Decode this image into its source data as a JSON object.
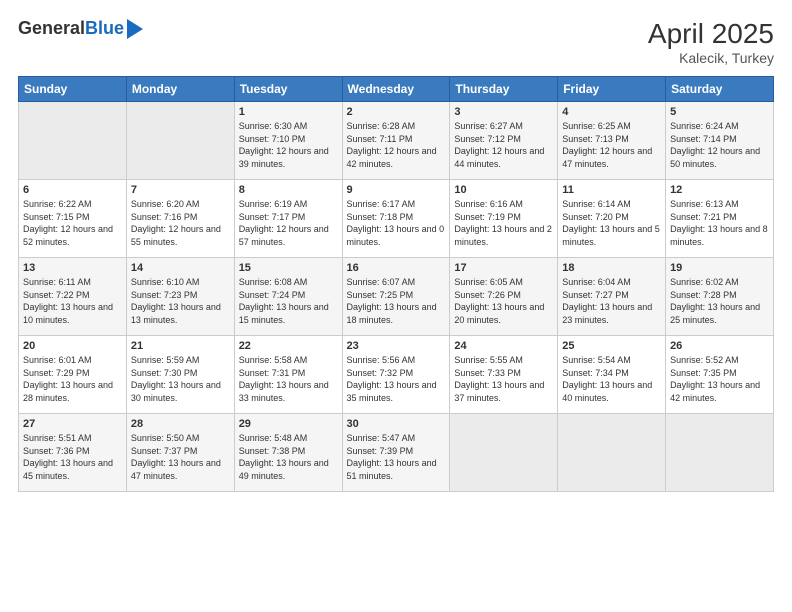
{
  "header": {
    "logo_general": "General",
    "logo_blue": "Blue",
    "month": "April 2025",
    "location": "Kalecik, Turkey"
  },
  "days_of_week": [
    "Sunday",
    "Monday",
    "Tuesday",
    "Wednesday",
    "Thursday",
    "Friday",
    "Saturday"
  ],
  "weeks": [
    [
      {
        "day": "",
        "info": ""
      },
      {
        "day": "",
        "info": ""
      },
      {
        "day": "1",
        "info": "Sunrise: 6:30 AM\nSunset: 7:10 PM\nDaylight: 12 hours and 39 minutes."
      },
      {
        "day": "2",
        "info": "Sunrise: 6:28 AM\nSunset: 7:11 PM\nDaylight: 12 hours and 42 minutes."
      },
      {
        "day": "3",
        "info": "Sunrise: 6:27 AM\nSunset: 7:12 PM\nDaylight: 12 hours and 44 minutes."
      },
      {
        "day": "4",
        "info": "Sunrise: 6:25 AM\nSunset: 7:13 PM\nDaylight: 12 hours and 47 minutes."
      },
      {
        "day": "5",
        "info": "Sunrise: 6:24 AM\nSunset: 7:14 PM\nDaylight: 12 hours and 50 minutes."
      }
    ],
    [
      {
        "day": "6",
        "info": "Sunrise: 6:22 AM\nSunset: 7:15 PM\nDaylight: 12 hours and 52 minutes."
      },
      {
        "day": "7",
        "info": "Sunrise: 6:20 AM\nSunset: 7:16 PM\nDaylight: 12 hours and 55 minutes."
      },
      {
        "day": "8",
        "info": "Sunrise: 6:19 AM\nSunset: 7:17 PM\nDaylight: 12 hours and 57 minutes."
      },
      {
        "day": "9",
        "info": "Sunrise: 6:17 AM\nSunset: 7:18 PM\nDaylight: 13 hours and 0 minutes."
      },
      {
        "day": "10",
        "info": "Sunrise: 6:16 AM\nSunset: 7:19 PM\nDaylight: 13 hours and 2 minutes."
      },
      {
        "day": "11",
        "info": "Sunrise: 6:14 AM\nSunset: 7:20 PM\nDaylight: 13 hours and 5 minutes."
      },
      {
        "day": "12",
        "info": "Sunrise: 6:13 AM\nSunset: 7:21 PM\nDaylight: 13 hours and 8 minutes."
      }
    ],
    [
      {
        "day": "13",
        "info": "Sunrise: 6:11 AM\nSunset: 7:22 PM\nDaylight: 13 hours and 10 minutes."
      },
      {
        "day": "14",
        "info": "Sunrise: 6:10 AM\nSunset: 7:23 PM\nDaylight: 13 hours and 13 minutes."
      },
      {
        "day": "15",
        "info": "Sunrise: 6:08 AM\nSunset: 7:24 PM\nDaylight: 13 hours and 15 minutes."
      },
      {
        "day": "16",
        "info": "Sunrise: 6:07 AM\nSunset: 7:25 PM\nDaylight: 13 hours and 18 minutes."
      },
      {
        "day": "17",
        "info": "Sunrise: 6:05 AM\nSunset: 7:26 PM\nDaylight: 13 hours and 20 minutes."
      },
      {
        "day": "18",
        "info": "Sunrise: 6:04 AM\nSunset: 7:27 PM\nDaylight: 13 hours and 23 minutes."
      },
      {
        "day": "19",
        "info": "Sunrise: 6:02 AM\nSunset: 7:28 PM\nDaylight: 13 hours and 25 minutes."
      }
    ],
    [
      {
        "day": "20",
        "info": "Sunrise: 6:01 AM\nSunset: 7:29 PM\nDaylight: 13 hours and 28 minutes."
      },
      {
        "day": "21",
        "info": "Sunrise: 5:59 AM\nSunset: 7:30 PM\nDaylight: 13 hours and 30 minutes."
      },
      {
        "day": "22",
        "info": "Sunrise: 5:58 AM\nSunset: 7:31 PM\nDaylight: 13 hours and 33 minutes."
      },
      {
        "day": "23",
        "info": "Sunrise: 5:56 AM\nSunset: 7:32 PM\nDaylight: 13 hours and 35 minutes."
      },
      {
        "day": "24",
        "info": "Sunrise: 5:55 AM\nSunset: 7:33 PM\nDaylight: 13 hours and 37 minutes."
      },
      {
        "day": "25",
        "info": "Sunrise: 5:54 AM\nSunset: 7:34 PM\nDaylight: 13 hours and 40 minutes."
      },
      {
        "day": "26",
        "info": "Sunrise: 5:52 AM\nSunset: 7:35 PM\nDaylight: 13 hours and 42 minutes."
      }
    ],
    [
      {
        "day": "27",
        "info": "Sunrise: 5:51 AM\nSunset: 7:36 PM\nDaylight: 13 hours and 45 minutes."
      },
      {
        "day": "28",
        "info": "Sunrise: 5:50 AM\nSunset: 7:37 PM\nDaylight: 13 hours and 47 minutes."
      },
      {
        "day": "29",
        "info": "Sunrise: 5:48 AM\nSunset: 7:38 PM\nDaylight: 13 hours and 49 minutes."
      },
      {
        "day": "30",
        "info": "Sunrise: 5:47 AM\nSunset: 7:39 PM\nDaylight: 13 hours and 51 minutes."
      },
      {
        "day": "",
        "info": ""
      },
      {
        "day": "",
        "info": ""
      },
      {
        "day": "",
        "info": ""
      }
    ]
  ]
}
